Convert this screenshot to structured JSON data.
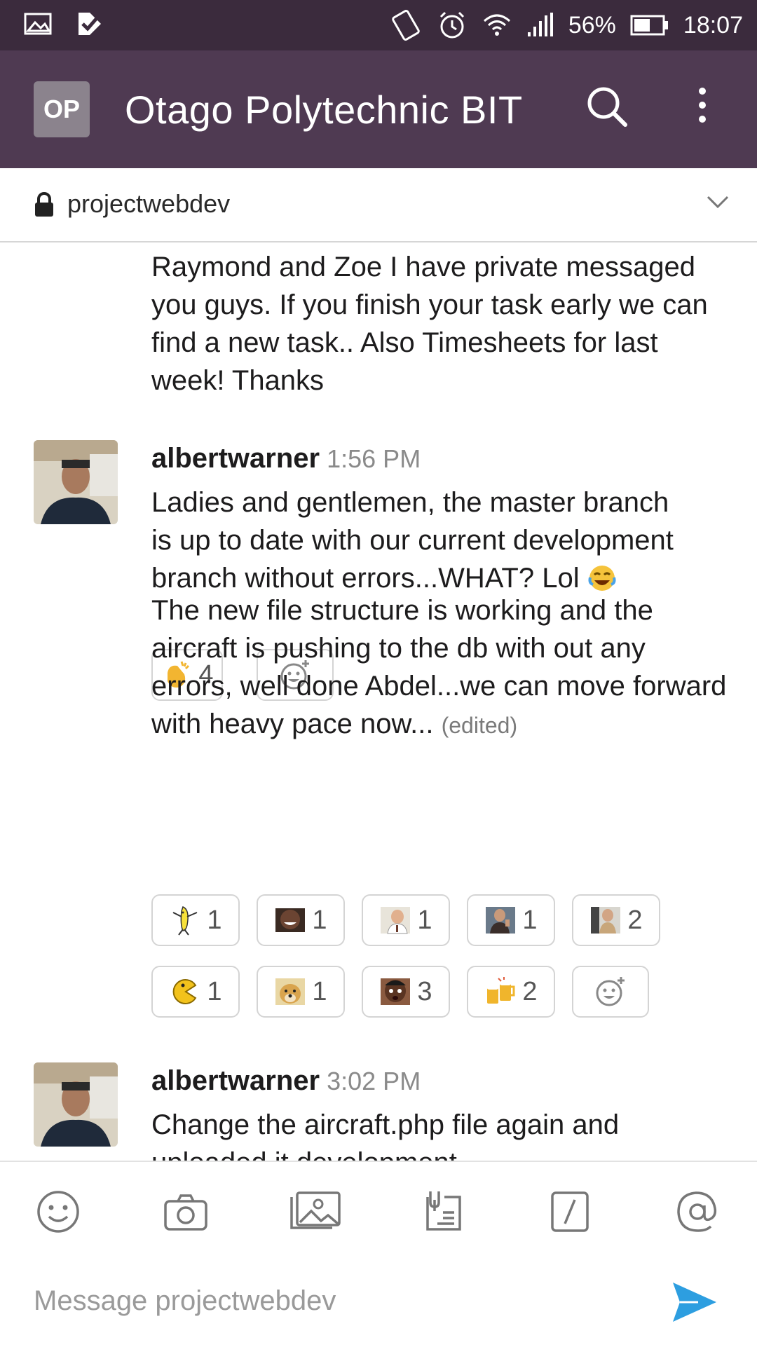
{
  "status_bar": {
    "battery_percent": "56%",
    "time": "18:07"
  },
  "header": {
    "team_initials": "OP",
    "team_name": "Otago Polytechnic BIT"
  },
  "channel": {
    "name": "projectwebdev"
  },
  "messages": [
    {
      "text": "Raymond and Zoe I have private messaged you guys. If you finish your task early we can find a new task.. Also Timesheets for last week! Thanks"
    },
    {
      "author": "albertwarner",
      "time": "1:56 PM",
      "text": "Ladies and gentlemen, the master branch is up to date with our current development branch without errors...WHAT? Lol",
      "reactions": [
        {
          "icon": "clapping-hands-emoji",
          "count": "4"
        }
      ]
    },
    {
      "text": "The new file structure is working and the aircraft is pushing to the db with out any errors, well done Abdel...we can move forward with heavy pace now...",
      "edited_label": "(edited)",
      "reactions": [
        {
          "icon": "dancing-banana-emoji",
          "count": "1"
        },
        {
          "icon": "laughing-face-emoji",
          "count": "1"
        },
        {
          "icon": "office-manager-emoji",
          "count": "1"
        },
        {
          "icon": "thumbs-up-man-emoji",
          "count": "1"
        },
        {
          "icon": "suited-man-emoji",
          "count": "2"
        },
        {
          "icon": "pacman-emoji",
          "count": "1"
        },
        {
          "icon": "doge-emoji",
          "count": "1"
        },
        {
          "icon": "surprised-kid-emoji",
          "count": "3"
        },
        {
          "icon": "beer-mugs-emoji",
          "count": "2"
        }
      ]
    },
    {
      "author": "albertwarner",
      "time": "3:02 PM",
      "text": "Change the aircraft.php file again and uploaded it development"
    }
  ],
  "composer": {
    "placeholder": "Message projectwebdev",
    "tools": [
      "emoji-icon",
      "camera-icon",
      "photo-gallery-icon",
      "file-upload-icon",
      "slash-command-icon",
      "mention-icon"
    ]
  },
  "colors": {
    "appbar": "#4f3a52",
    "statusbar": "#3b2b3d",
    "send": "#2d9ee0"
  }
}
